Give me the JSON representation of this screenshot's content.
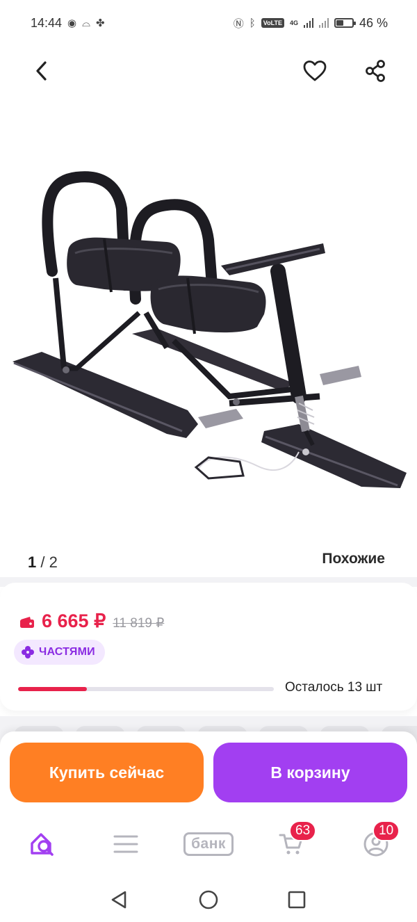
{
  "status_bar": {
    "time": "14:44",
    "network": "4G",
    "volte": "VoLTE",
    "battery_percent": "46 %",
    "battery_level": 0.46
  },
  "nav": {
    "back_icon": "chevron-left-icon",
    "favorite_icon": "heart-icon",
    "share_icon": "share-icon"
  },
  "gallery": {
    "current": "1",
    "total": "2",
    "separator": "/ ",
    "similar_label": "Похожие"
  },
  "product": {
    "price_current": "6 665 ₽",
    "price_old": "11 819 ₽",
    "installments_label": "ЧАСТЯМИ",
    "stock_text": "Осталось 13 шт",
    "stock_level": 0.27
  },
  "actions": {
    "buy_now": "Купить сейчас",
    "add_to_cart": "В корзину"
  },
  "tabs": {
    "bank_label": "банк",
    "cart_badge": "63",
    "profile_badge": "10"
  },
  "colors": {
    "accent_red": "#e8224b",
    "buy_orange": "#ff7f23",
    "cart_purple": "#a23ff1",
    "active_tab": "#a23ff1"
  }
}
